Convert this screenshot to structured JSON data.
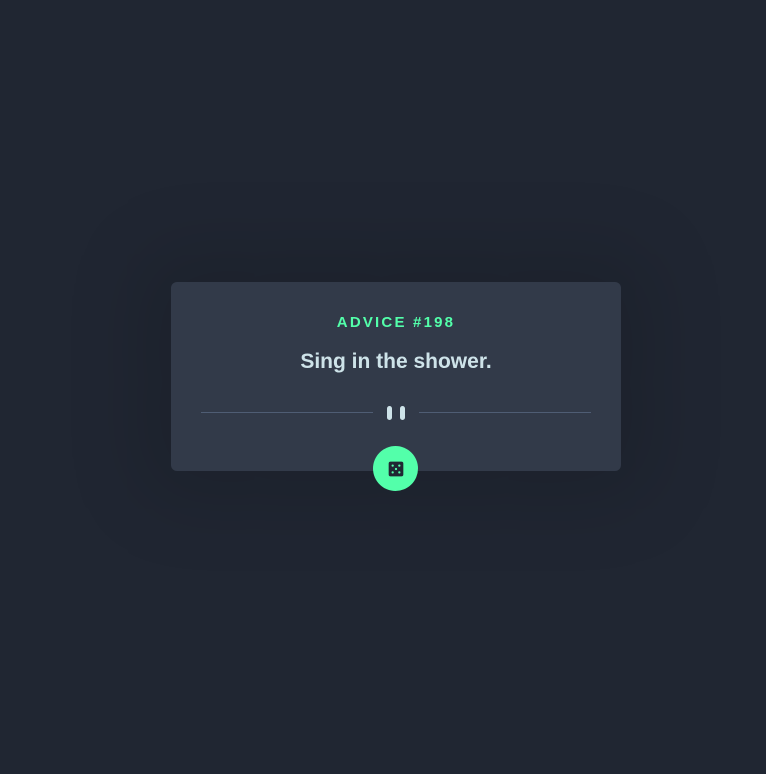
{
  "card": {
    "advice_id": "ADVICE #198",
    "advice_text": "Sing in the shower."
  },
  "icons": {
    "divider": "pause-icon",
    "button": "dice-icon"
  },
  "colors": {
    "background": "#202632",
    "card": "#323a49",
    "accent": "#53ffaa",
    "text": "#cee3e9",
    "divider": "#4f5d74"
  }
}
